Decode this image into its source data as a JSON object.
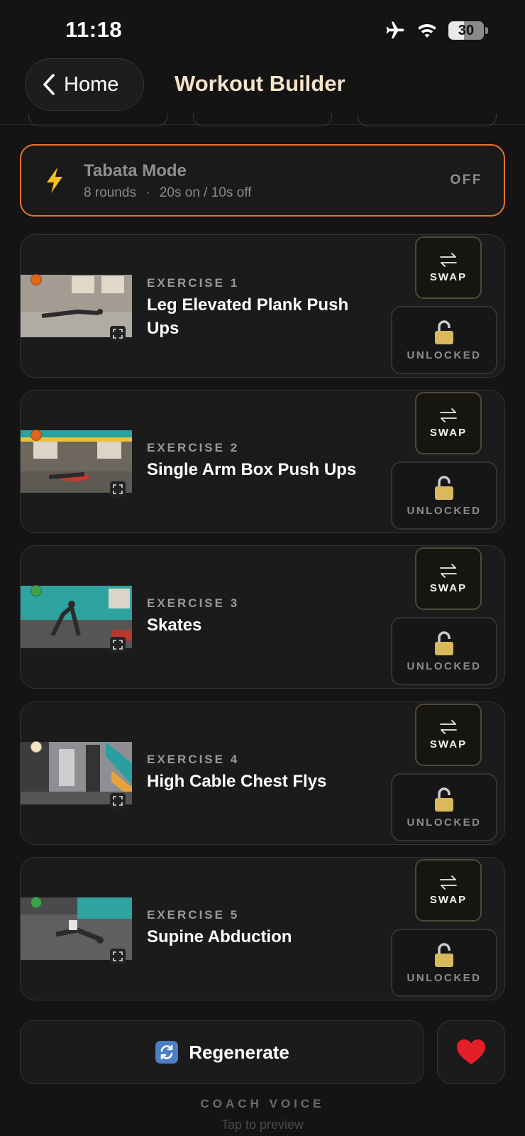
{
  "status_bar": {
    "time": "11:18",
    "battery": "30"
  },
  "header": {
    "back_label": "Home",
    "title": "Workout Builder"
  },
  "tabata": {
    "title": "Tabata Mode",
    "rounds": "8 rounds",
    "separator": "·",
    "timing": "20s on / 10s off",
    "state": "OFF"
  },
  "exercises": [
    {
      "number": "EXERCISE 1",
      "name": "Leg Elevated Plank Push Ups",
      "status_color": "#e0661a",
      "swap_label": "SWAP",
      "lock_label": "UNLOCKED"
    },
    {
      "number": "EXERCISE 2",
      "name": "Single Arm Box Push Ups",
      "status_color": "#e0661a",
      "swap_label": "SWAP",
      "lock_label": "UNLOCKED"
    },
    {
      "number": "EXERCISE 3",
      "name": "Skates",
      "status_color": "#3fa34d",
      "swap_label": "SWAP",
      "lock_label": "UNLOCKED"
    },
    {
      "number": "EXERCISE 4",
      "name": "High Cable Chest Flys",
      "status_color": "#f3e2c4",
      "swap_label": "SWAP",
      "lock_label": "UNLOCKED"
    },
    {
      "number": "EXERCISE 5",
      "name": "Supine Abduction",
      "status_color": "#3fa34d",
      "swap_label": "SWAP",
      "lock_label": "UNLOCKED"
    }
  ],
  "actions": {
    "regenerate_label": "Regenerate",
    "regenerate_icon": "refresh-icon",
    "favorite_icon": "heart-icon"
  },
  "coach_voice": {
    "title": "COACH VOICE",
    "subtitle": "Tap to preview"
  },
  "colors": {
    "accent": "#e8722c",
    "title": "#f6e3c8"
  }
}
